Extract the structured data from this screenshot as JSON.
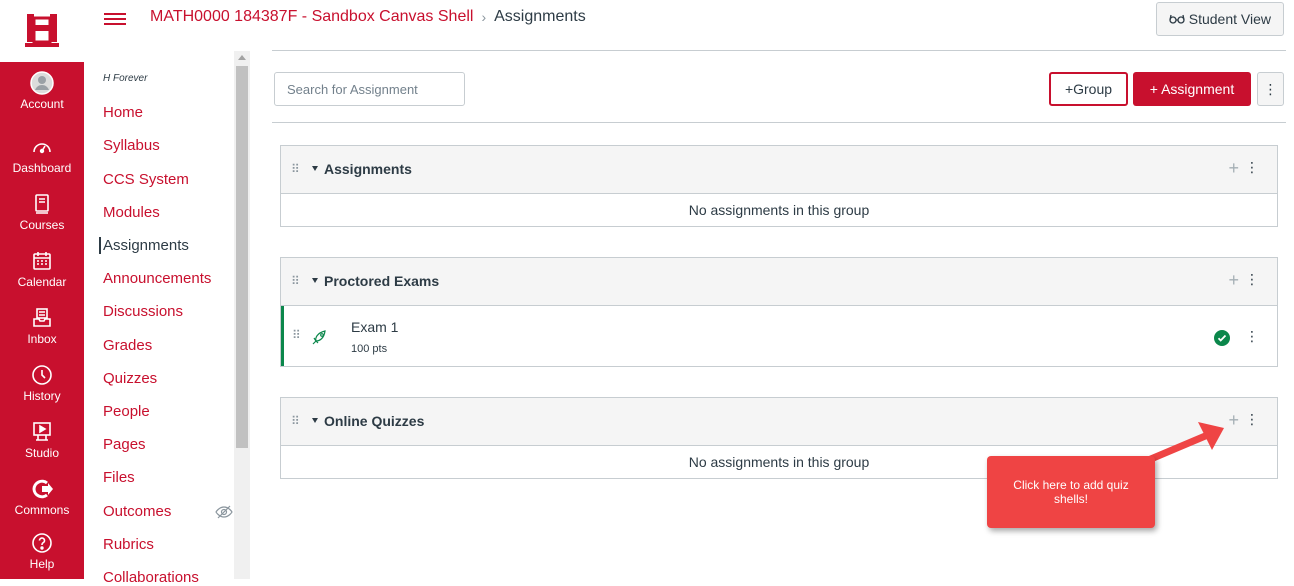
{
  "global_nav": {
    "items": [
      {
        "label": "Account",
        "icon": "account-icon"
      },
      {
        "label": "Dashboard",
        "icon": "dashboard-icon"
      },
      {
        "label": "Courses",
        "icon": "courses-icon"
      },
      {
        "label": "Calendar",
        "icon": "calendar-icon"
      },
      {
        "label": "Inbox",
        "icon": "inbox-icon"
      },
      {
        "label": "History",
        "icon": "history-icon"
      },
      {
        "label": "Studio",
        "icon": "studio-icon"
      },
      {
        "label": "Commons",
        "icon": "commons-icon"
      },
      {
        "label": "Help",
        "icon": "help-icon"
      }
    ],
    "brand_color": "#c8102e"
  },
  "header": {
    "course_link": "MATH0000 184387F - Sandbox Canvas Shell",
    "separator": "›",
    "current": "Assignments",
    "student_view_label": "Student View"
  },
  "course_nav": {
    "subtitle": "H Forever",
    "items": [
      {
        "label": "Home"
      },
      {
        "label": "Syllabus"
      },
      {
        "label": "CCS System"
      },
      {
        "label": "Modules"
      },
      {
        "label": "Assignments",
        "active": true
      },
      {
        "label": "Announcements"
      },
      {
        "label": "Discussions"
      },
      {
        "label": "Grades"
      },
      {
        "label": "Quizzes"
      },
      {
        "label": "People"
      },
      {
        "label": "Pages"
      },
      {
        "label": "Files"
      },
      {
        "label": "Outcomes"
      },
      {
        "label": "Rubrics"
      },
      {
        "label": "Collaborations"
      }
    ]
  },
  "toolbar": {
    "search_placeholder": "Search for Assignment",
    "group_button": "+Group",
    "assignment_button": "+ Assignment",
    "kebab": "⋮"
  },
  "groups": [
    {
      "title": "Assignments",
      "empty_text": "No assignments in this group"
    },
    {
      "title": "Proctored Exams",
      "items": [
        {
          "title": "Exam 1",
          "points": "100 pts",
          "status_color": "#0b874b"
        }
      ]
    },
    {
      "title": "Online Quizzes",
      "empty_text": "No assignments in this group"
    }
  ],
  "callout": {
    "text": "Click here to add quiz shells!",
    "color": "#ef4444"
  }
}
